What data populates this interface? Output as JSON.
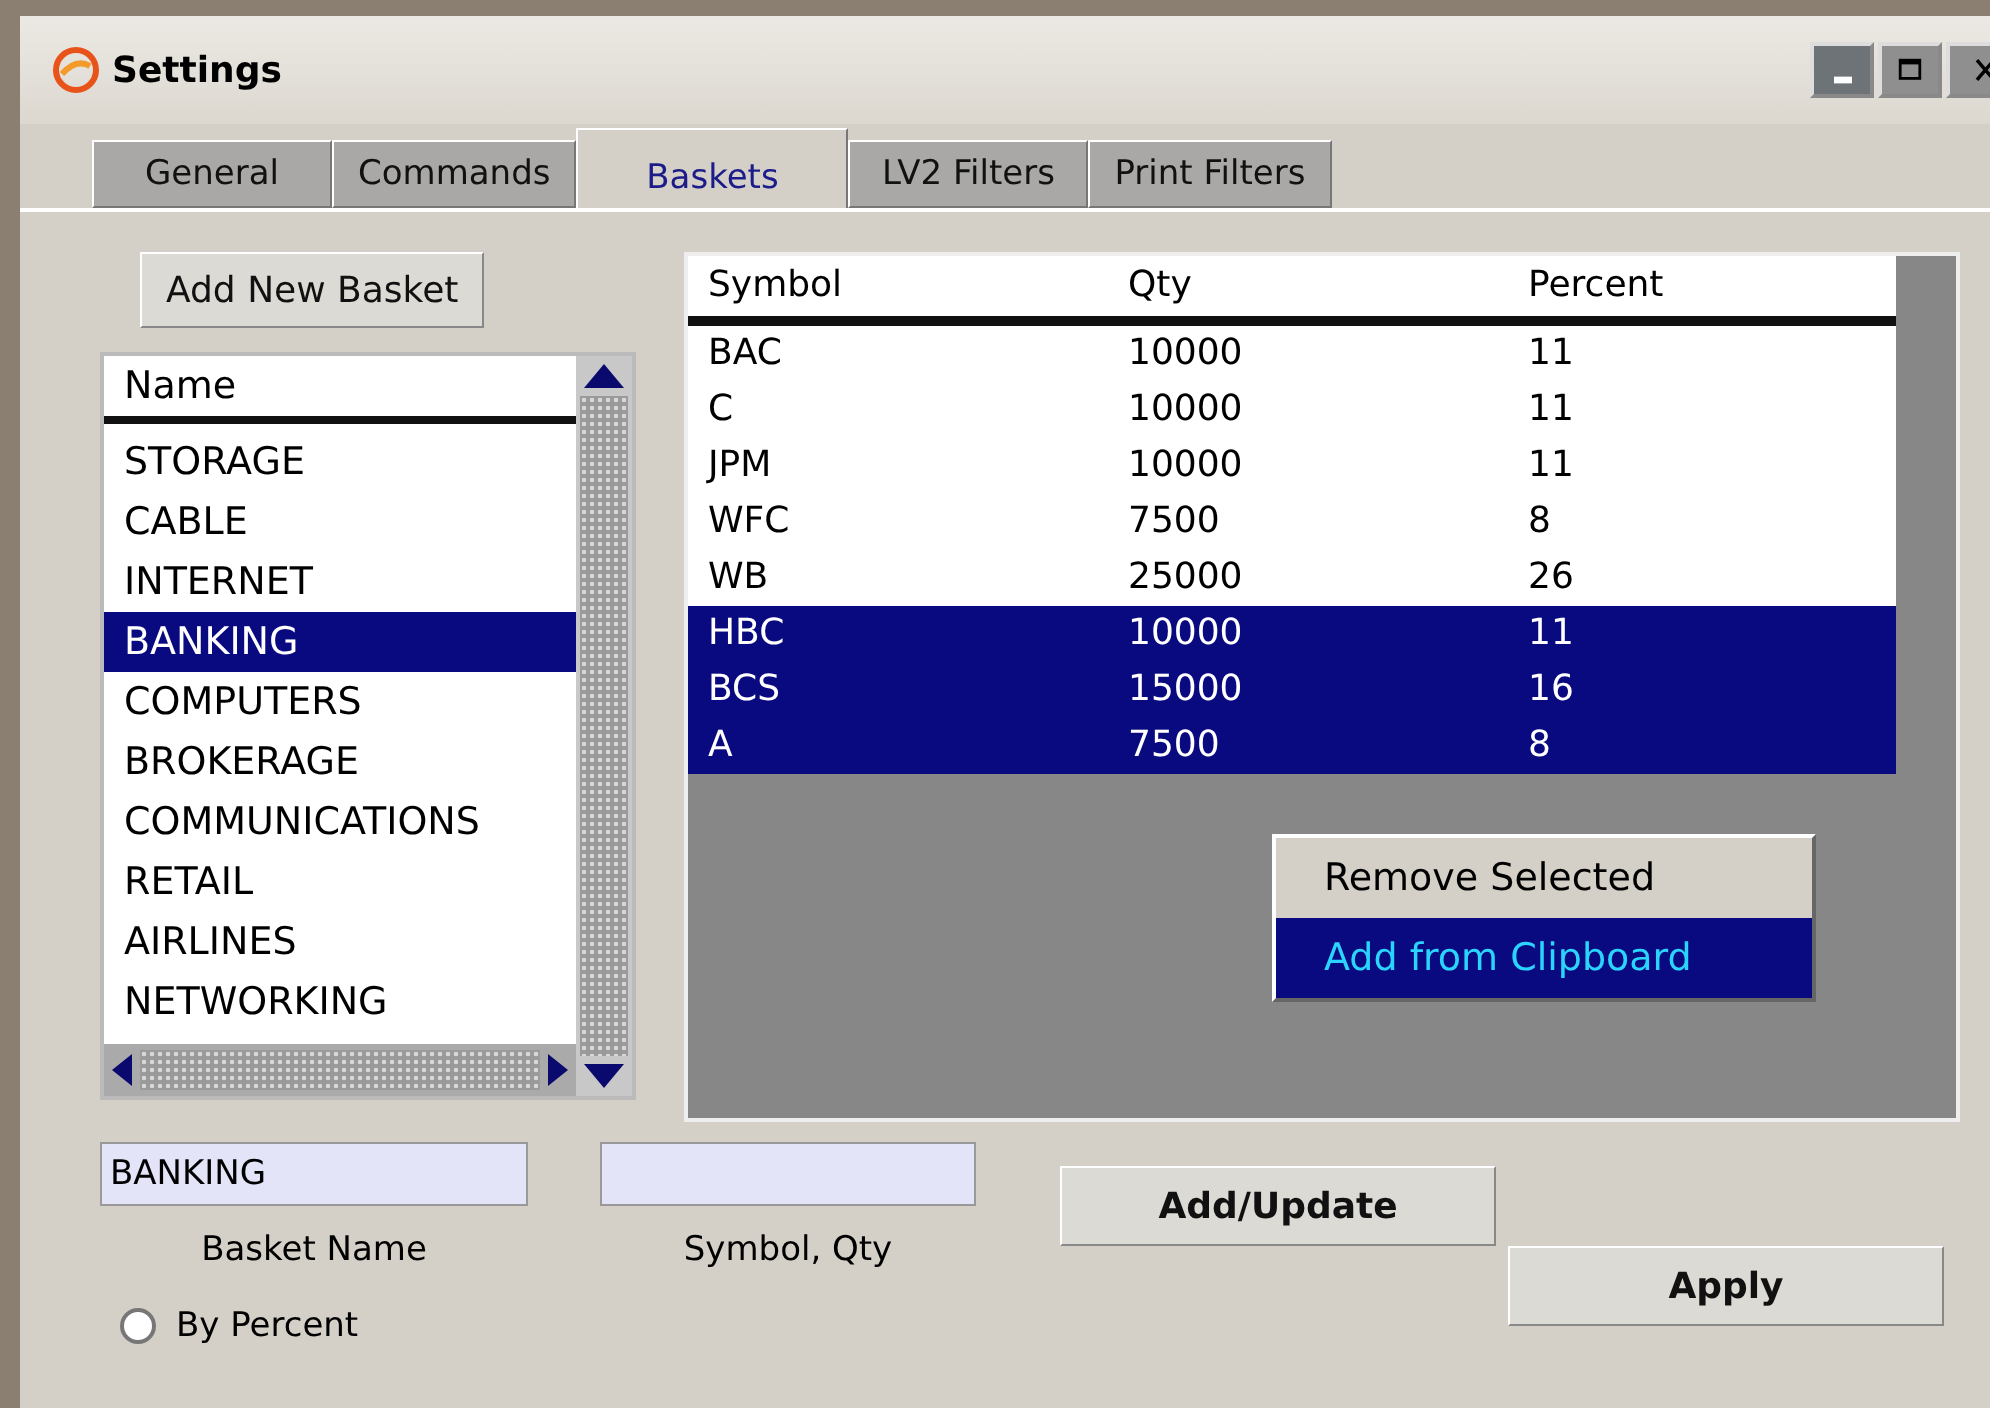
{
  "window": {
    "title": "Settings"
  },
  "tabs": [
    {
      "label": "General",
      "selected": false
    },
    {
      "label": "Commands",
      "selected": false
    },
    {
      "label": "Baskets",
      "selected": true
    },
    {
      "label": "LV2 Filters",
      "selected": false
    },
    {
      "label": "Print Filters",
      "selected": false
    }
  ],
  "add_basket_button": "Add New Basket",
  "basket_list": {
    "column": "Name",
    "items": [
      {
        "label": "STORAGE",
        "selected": false
      },
      {
        "label": "CABLE",
        "selected": false
      },
      {
        "label": "INTERNET",
        "selected": false
      },
      {
        "label": "BANKING",
        "selected": true
      },
      {
        "label": "COMPUTERS",
        "selected": false
      },
      {
        "label": "BROKERAGE",
        "selected": false
      },
      {
        "label": "COMMUNICATIONS",
        "selected": false
      },
      {
        "label": "RETAIL",
        "selected": false
      },
      {
        "label": "AIRLINES",
        "selected": false
      },
      {
        "label": "NETWORKING",
        "selected": false
      }
    ]
  },
  "table": {
    "columns": [
      "Symbol",
      "Qty",
      "Percent"
    ],
    "rows": [
      {
        "cells": [
          "BAC",
          "10000",
          "11"
        ],
        "selected": false
      },
      {
        "cells": [
          "C",
          "10000",
          "11"
        ],
        "selected": false
      },
      {
        "cells": [
          "JPM",
          "10000",
          "11"
        ],
        "selected": false
      },
      {
        "cells": [
          "WFC",
          "7500",
          "8"
        ],
        "selected": false
      },
      {
        "cells": [
          "WB",
          "25000",
          "26"
        ],
        "selected": false
      },
      {
        "cells": [
          "HBC",
          "10000",
          "11"
        ],
        "selected": true
      },
      {
        "cells": [
          "BCS",
          "15000",
          "16"
        ],
        "selected": true
      },
      {
        "cells": [
          "A",
          "7500",
          "8"
        ],
        "selected": true
      }
    ]
  },
  "context_menu": [
    {
      "label": "Remove Selected",
      "selected": false
    },
    {
      "label": "Add from Clipboard",
      "selected": true
    }
  ],
  "basket_name_field": {
    "value": "BANKING",
    "label": "Basket Name"
  },
  "symbol_qty_field": {
    "label": "Symbol, Qty"
  },
  "add_update_button": "Add/Update",
  "by_percent": {
    "label": "By Percent",
    "checked": false
  },
  "apply_button": "Apply"
}
